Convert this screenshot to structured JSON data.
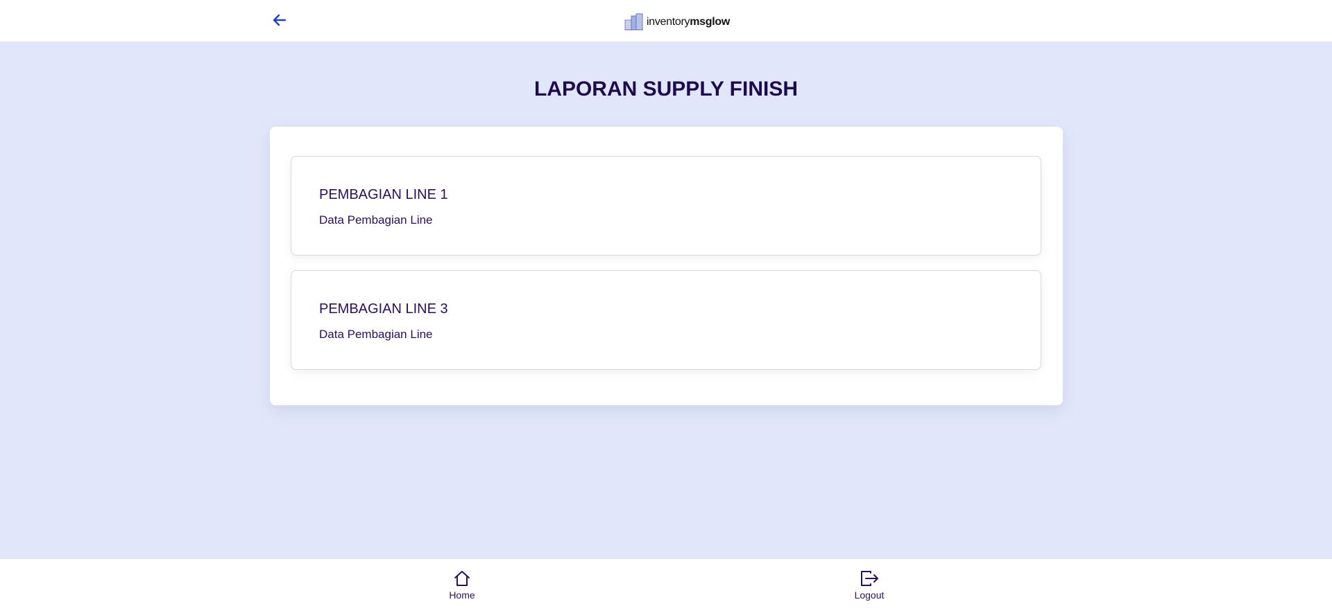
{
  "header": {
    "back_icon": "arrow-left-icon",
    "logo": {
      "icon": "boxes-logo-icon",
      "text_regular": "inventory",
      "text_bold": "msglow"
    }
  },
  "page": {
    "title": "LAPORAN SUPPLY FINISH"
  },
  "cards": [
    {
      "title": "PEMBAGIAN LINE 1",
      "subtitle": "Data Pembagian Line"
    },
    {
      "title": "PEMBAGIAN LINE 3",
      "subtitle": "Data Pembagian Line"
    }
  ],
  "bottom_nav": [
    {
      "label": "Home",
      "icon": "home-icon"
    },
    {
      "label": "Logout",
      "icon": "logout-icon"
    }
  ],
  "colors": {
    "background": "#e1e7fb",
    "title": "#1e0a4e",
    "text": "#2a0f5c",
    "accent": "#1f3fd1"
  }
}
